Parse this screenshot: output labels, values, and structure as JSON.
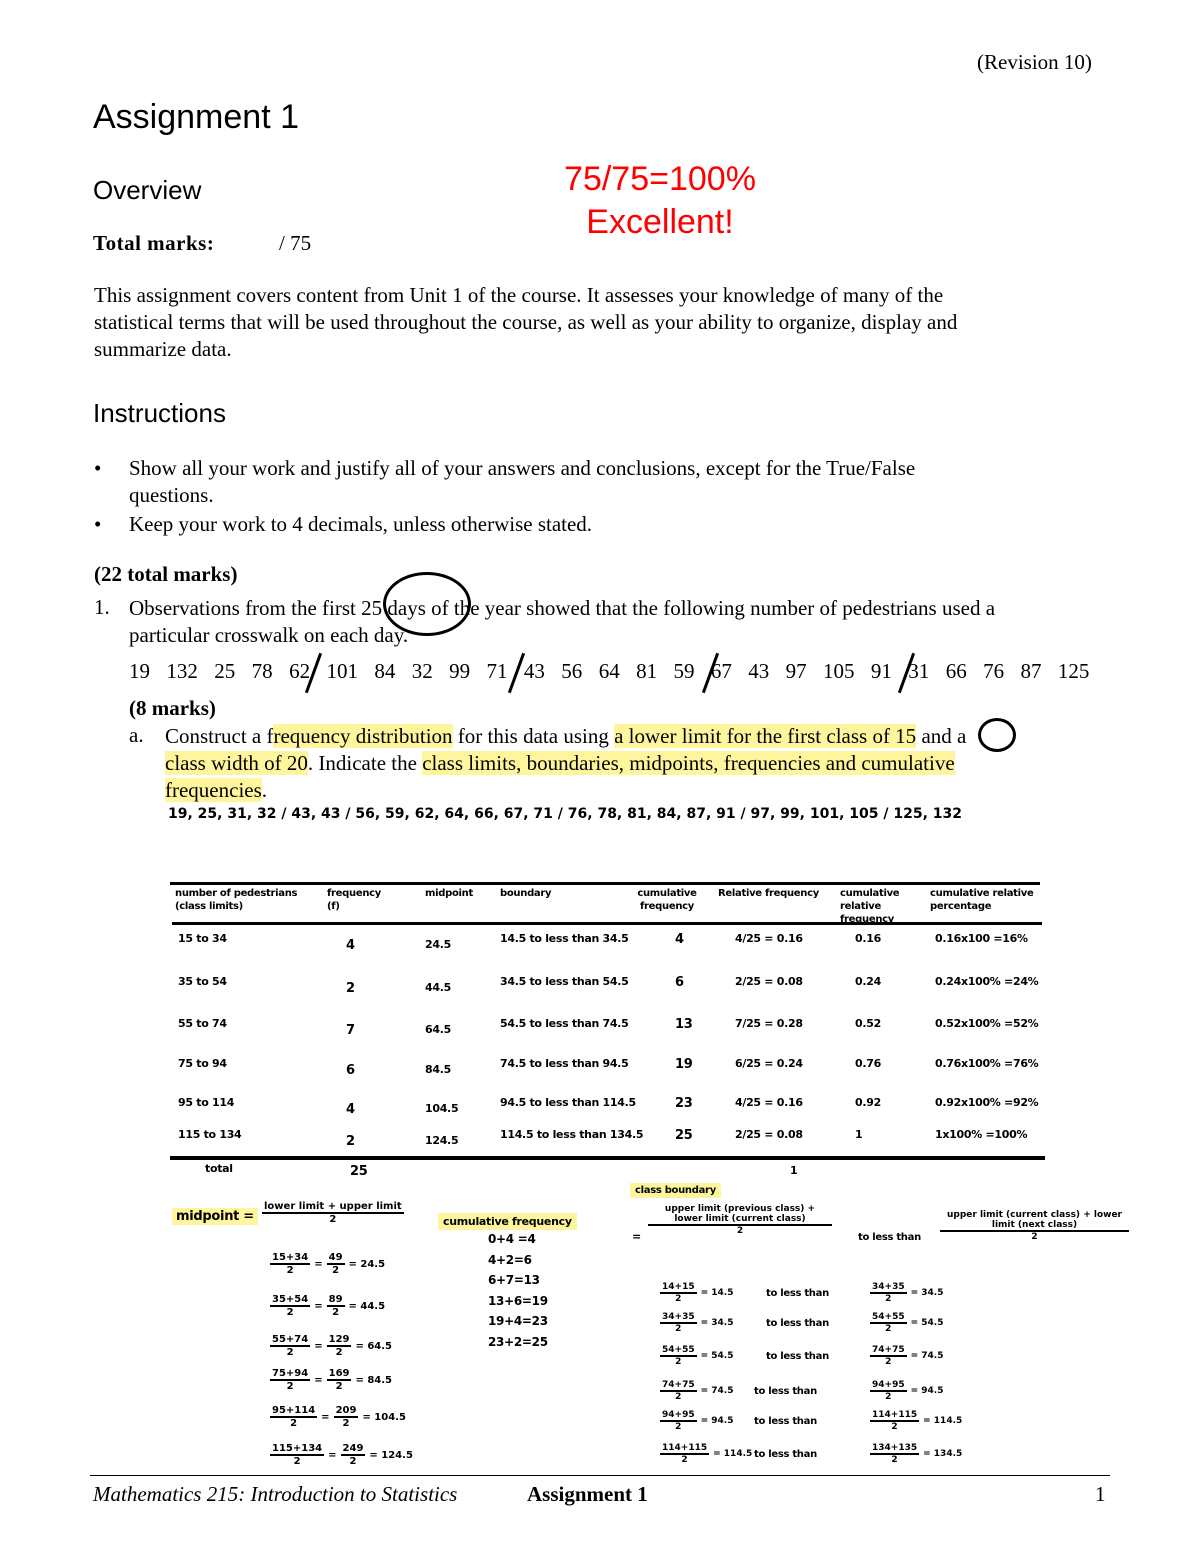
{
  "revision": "(Revision 10)",
  "title": "Assignment 1",
  "overview_heading": "Overview",
  "grade": {
    "score": "75/75=100%",
    "comment": "Excellent!",
    "color": "#ff0000"
  },
  "total_marks_label": "Total marks:",
  "total_marks_value": "/ 75",
  "intro": [
    "This assignment covers content from Unit 1 of the course. It assesses your knowledge of many of the",
    "statistical terms that will be used throughout the course, as well as your ability to organize, display and",
    "summarize data."
  ],
  "instructions_heading": "Instructions",
  "instructions": [
    [
      "Show all your work and justify all of your answers and conclusions, except for the True/False",
      "questions."
    ],
    [
      "Keep your work to 4 decimals, unless otherwise stated."
    ]
  ],
  "section_marks": "(22 total marks)",
  "q1": {
    "number": "1.",
    "text": [
      "Observations from the first 25 days of the year showed that the following number of pedestrians used a",
      "particular crosswalk on each day."
    ],
    "data": [
      "19",
      "132",
      "25",
      "78",
      "62",
      "101",
      "84",
      "32",
      "99",
      "71",
      "43",
      "56",
      "64",
      "81",
      "59",
      "67",
      "43",
      "97",
      "105",
      "91",
      "31",
      "66",
      "76",
      "87",
      "125"
    ]
  },
  "qa": {
    "marks": "(8 marks)",
    "letter": "a.",
    "parts": [
      "Construct a f",
      "requency distribution",
      " for this data using ",
      "a lower limit for the first class of 15",
      " and a",
      "class width of 20",
      ". Indicate the ",
      "class limits, boundaries, midpoints, frequencies and cumulative",
      "frequencies",
      "."
    ]
  },
  "sorted_data": "19, 25, 31, 32 / 43, 43 / 56, 59, 62, 64, 66, 67, 71 / 76, 78, 81, 84, 87, 91 / 97, 99, 101, 105 / 125, 132",
  "table": {
    "headers": [
      "number of pedestrians (class limits)",
      "frequency (f)",
      "midpoint",
      "boundary",
      "cumulative frequency",
      "Relative frequency",
      "cumulative relative frequency",
      "cumulative relative percentage"
    ],
    "rows": [
      [
        "15 to 34",
        "4",
        "24.5",
        "14.5 to less than 34.5",
        "4",
        "4/25 = 0.16",
        "0.16",
        "0.16x100 =16%"
      ],
      [
        "35 to 54",
        "2",
        "44.5",
        "34.5 to less than 54.5",
        "6",
        "2/25 = 0.08",
        "0.24",
        "0.24x100% =24%"
      ],
      [
        "55 to 74",
        "7",
        "64.5",
        "54.5 to less than 74.5",
        "13",
        "7/25 = 0.28",
        "0.52",
        "0.52x100% =52%"
      ],
      [
        "75 to 94",
        "6",
        "84.5",
        "74.5 to less than 94.5",
        "19",
        "6/25 = 0.24",
        "0.76",
        "0.76x100% =76%"
      ],
      [
        "95 to 114",
        "4",
        "104.5",
        "94.5 to less than 114.5",
        "23",
        "4/25 = 0.16",
        "0.92",
        "0.92x100% =92%"
      ],
      [
        "115 to 134",
        "2",
        "124.5",
        "114.5 to less than 134.5",
        "25",
        "2/25 = 0.08",
        "1",
        "1x100% =100%"
      ]
    ],
    "total": [
      "total",
      "25",
      "1"
    ]
  },
  "work": {
    "midpoint_label": "midpoint =",
    "midpoint_num": "lower limit + upper limit",
    "midpoint_den": "2",
    "midpoints": [
      [
        "15+34",
        "2",
        "49",
        "2",
        "= 24.5"
      ],
      [
        "35+54",
        "2",
        "89",
        "2",
        "= 44.5"
      ],
      [
        "55+74",
        "2",
        "129",
        "2",
        "= 64.5"
      ],
      [
        "75+94",
        "2",
        "169",
        "2",
        "= 84.5"
      ],
      [
        "95+114",
        "2",
        "209",
        "2",
        "= 104.5"
      ],
      [
        "115+134",
        "2",
        "249",
        "2",
        "= 124.5"
      ]
    ],
    "cumfreq_label": "cumulative frequency",
    "cumfreq": [
      "0+4 =4",
      "4+2=6",
      "6+7=13",
      "13+6=19",
      "19+4=23",
      "23+2=25"
    ],
    "boundary_label": "class boundary",
    "boundary_eq": "=",
    "boundary_left_num": [
      "upper limit (previous class)",
      "+",
      "lower limit (current class)"
    ],
    "boundary_den": "2",
    "to_less_than": "to less than",
    "boundary_right_num": [
      "upper limit (current class)",
      "+",
      "lower limit (next class)"
    ],
    "boundaries": [
      [
        "14+15",
        "2",
        "= 14.5",
        "34+35",
        "2",
        "= 34.5"
      ],
      [
        "34+35",
        "2",
        "= 34.5",
        "54+55",
        "2",
        "= 54.5"
      ],
      [
        "54+55",
        "2",
        "= 54.5",
        "74+75",
        "2",
        "= 74.5"
      ],
      [
        "74+75",
        "2",
        "= 74.5",
        "94+95",
        "2",
        "= 94.5"
      ],
      [
        "94+95",
        "2",
        "= 94.5",
        "114+115",
        "2",
        "= 114.5"
      ],
      [
        "114+115",
        "2",
        "= 114.5",
        "134+135",
        "2",
        "= 134.5"
      ]
    ]
  },
  "footer": {
    "course": "Mathematics 215: Introduction to Statistics",
    "assignment": "Assignment 1",
    "page": "1"
  }
}
